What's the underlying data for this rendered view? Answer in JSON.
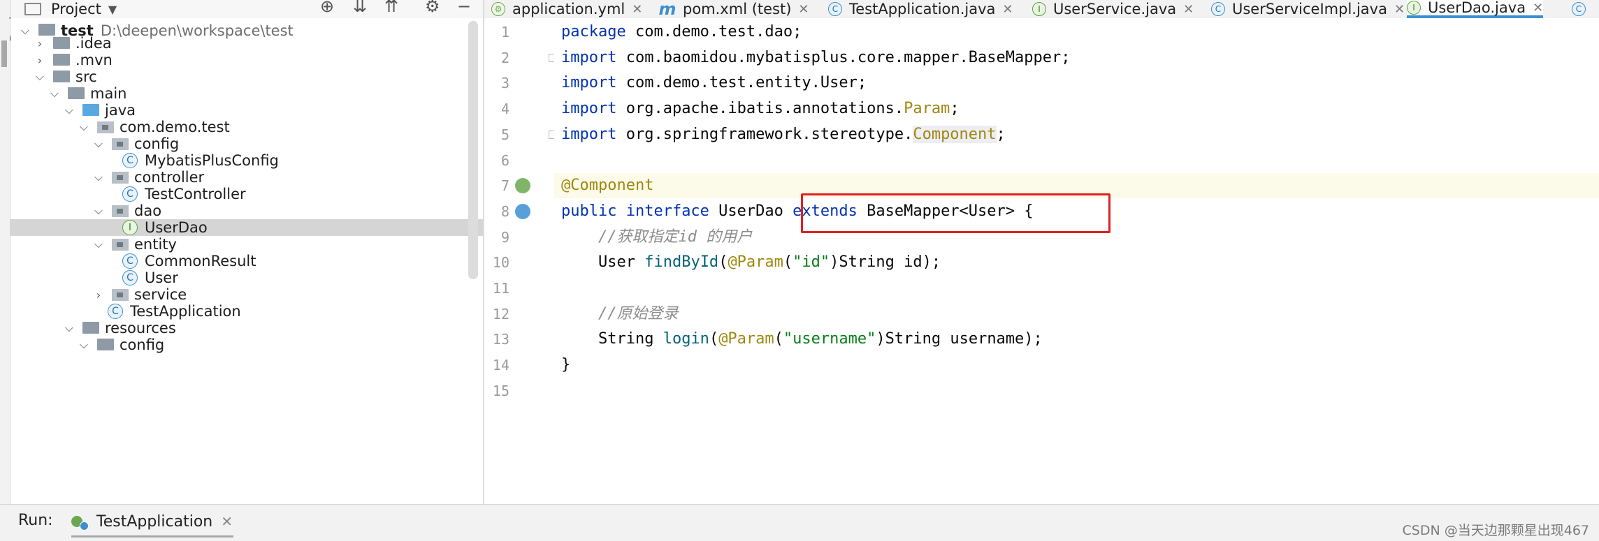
{
  "project_panel": {
    "title": "Project",
    "strip_label": "Project"
  },
  "tree": {
    "root_name": "test",
    "root_path": "D:\\deepen\\workspace\\test",
    "items": [
      {
        "label": ".idea",
        "level": 1,
        "icon": "folder",
        "arrow": "right"
      },
      {
        "label": ".mvn",
        "level": 1,
        "icon": "folder",
        "arrow": "right"
      },
      {
        "label": "src",
        "level": 1,
        "icon": "folder",
        "arrow": "down"
      },
      {
        "label": "main",
        "level": 2,
        "icon": "folder",
        "arrow": "down"
      },
      {
        "label": "java",
        "level": 3,
        "icon": "folder-blue",
        "arrow": "down"
      },
      {
        "label": "com.demo.test",
        "level": 4,
        "icon": "package",
        "arrow": "down"
      },
      {
        "label": "config",
        "level": 5,
        "icon": "package",
        "arrow": "down"
      },
      {
        "label": "MybatisPlusConfig",
        "level": 6,
        "icon": "class",
        "arrow": ""
      },
      {
        "label": "controller",
        "level": 5,
        "icon": "package",
        "arrow": "down"
      },
      {
        "label": "TestController",
        "level": 6,
        "icon": "class",
        "arrow": ""
      },
      {
        "label": "dao",
        "level": 5,
        "icon": "package",
        "arrow": "down"
      },
      {
        "label": "UserDao",
        "level": 6,
        "icon": "interface",
        "arrow": "",
        "selected": true
      },
      {
        "label": "entity",
        "level": 5,
        "icon": "package",
        "arrow": "down"
      },
      {
        "label": "CommonResult",
        "level": 6,
        "icon": "class",
        "arrow": ""
      },
      {
        "label": "User",
        "level": 6,
        "icon": "class",
        "arrow": ""
      },
      {
        "label": "service",
        "level": 5,
        "icon": "package",
        "arrow": "right"
      },
      {
        "label": "TestApplication",
        "level": 5,
        "icon": "spring-class",
        "arrow": ""
      },
      {
        "label": "resources",
        "level": 3,
        "icon": "folder",
        "arrow": "down"
      },
      {
        "label": "config",
        "level": 4,
        "icon": "folder",
        "arrow": "down"
      }
    ]
  },
  "tabs": [
    {
      "label": "application.yml",
      "icon": "yml",
      "x": 0
    },
    {
      "label": "pom.xml (test)",
      "icon": "maven",
      "x": 0
    },
    {
      "label": "TestApplication.java",
      "icon": "class",
      "x": 0
    },
    {
      "label": "UserService.java",
      "icon": "interface",
      "x": 0
    },
    {
      "label": "UserServiceImpl.java",
      "icon": "class",
      "x": 0
    },
    {
      "label": "UserDao.java",
      "icon": "interface",
      "active": true,
      "x": 0
    }
  ],
  "editor": {
    "lines": [
      {
        "n": "1",
        "segments": [
          {
            "t": "package ",
            "c": "kw"
          },
          {
            "t": "com.demo.test.dao;"
          }
        ]
      },
      {
        "n": "2",
        "segments": [
          {
            "t": "import ",
            "c": "kw"
          },
          {
            "t": "com.baomidou.mybatisplus.core.mapper.BaseMapper;"
          }
        ]
      },
      {
        "n": "3",
        "segments": [
          {
            "t": "import ",
            "c": "kw"
          },
          {
            "t": "com.demo.test.entity.User;"
          }
        ]
      },
      {
        "n": "4",
        "segments": [
          {
            "t": "import ",
            "c": "kw"
          },
          {
            "t": "org.apache.ibatis.annotations."
          },
          {
            "t": "Param",
            "c": "ann"
          },
          {
            "t": ";"
          }
        ]
      },
      {
        "n": "5",
        "segments": [
          {
            "t": "import ",
            "c": "kw"
          },
          {
            "t": "org.springframework.stereotype."
          },
          {
            "t": "Component",
            "c": "ann hlbg"
          },
          {
            "t": ";"
          }
        ]
      },
      {
        "n": "6",
        "segments": []
      },
      {
        "n": "7",
        "segments": [
          {
            "t": "@Component",
            "c": "ann"
          }
        ],
        "current": true
      },
      {
        "n": "8",
        "segments": [
          {
            "t": "public ",
            "c": "kw"
          },
          {
            "t": "interface ",
            "c": "kw"
          },
          {
            "t": "UserDao "
          },
          {
            "t": "extends ",
            "c": "kw"
          },
          {
            "t": "BaseMapper<User> {"
          }
        ]
      },
      {
        "n": "9",
        "segments": [
          {
            "t": "    "
          },
          {
            "t": "//获取指定id 的用户",
            "c": "cm"
          }
        ]
      },
      {
        "n": "10",
        "segments": [
          {
            "t": "    User "
          },
          {
            "t": "findById",
            "c": "fn"
          },
          {
            "t": "("
          },
          {
            "t": "@Param",
            "c": "ann"
          },
          {
            "t": "("
          },
          {
            "t": "\"id\"",
            "c": "str"
          },
          {
            "t": ")String id);"
          }
        ]
      },
      {
        "n": "11",
        "segments": []
      },
      {
        "n": "12",
        "segments": [
          {
            "t": "    "
          },
          {
            "t": "//原始登录",
            "c": "cm"
          }
        ]
      },
      {
        "n": "13",
        "segments": [
          {
            "t": "    String "
          },
          {
            "t": "login",
            "c": "fn"
          },
          {
            "t": "("
          },
          {
            "t": "@Param",
            "c": "ann"
          },
          {
            "t": "("
          },
          {
            "t": "\"username\"",
            "c": "str"
          },
          {
            "t": ")String username);"
          }
        ]
      },
      {
        "n": "14",
        "segments": [
          {
            "t": "}"
          }
        ]
      },
      {
        "n": "15",
        "segments": []
      }
    ]
  },
  "run": {
    "label": "Run:",
    "tab": "TestApplication"
  },
  "watermark": "CSDN @当天边那颗星出现467",
  "colors": {
    "keyword": "#0033b3",
    "string": "#067d17",
    "annotation": "#9e880d",
    "comment": "#8c8c8c",
    "highlight_box": "#e02020",
    "accent": "#3b8fd0"
  }
}
